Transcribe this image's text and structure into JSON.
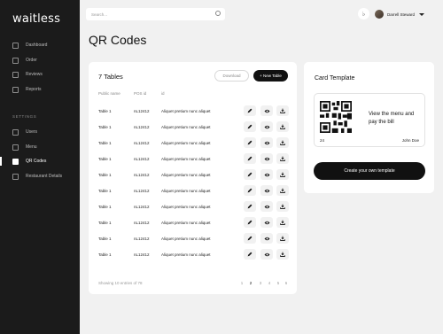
{
  "app": {
    "logo": "waitless"
  },
  "sidebar": {
    "items": [
      {
        "label": "Dashboard",
        "icon": "grid-icon"
      },
      {
        "label": "Order",
        "icon": "order-icon"
      },
      {
        "label": "Reviews",
        "icon": "thumbs-up-icon"
      },
      {
        "label": "Reports",
        "icon": "report-icon"
      }
    ],
    "settings_label": "SETTINGS",
    "settings_items": [
      {
        "label": "Users",
        "icon": "users-icon"
      },
      {
        "label": "Menu",
        "icon": "menu-icon"
      },
      {
        "label": "QR Codes",
        "icon": "qr-icon",
        "active": true
      },
      {
        "label": "Restaurant Details",
        "icon": "details-icon"
      }
    ]
  },
  "topbar": {
    "search_placeholder": "Search...",
    "user_name": "Darrell Steward"
  },
  "page": {
    "title": "QR Codes"
  },
  "tables": {
    "title": "7 Tables",
    "download_label": "Download",
    "new_table_label": "+ New Table",
    "columns": [
      "Public name",
      "POS id",
      "id"
    ],
    "rows": [
      {
        "name": "Table 1",
        "pos": "nL12412",
        "id": "Aliquet pretium nunc aliquet"
      },
      {
        "name": "Table 1",
        "pos": "nL12412",
        "id": "Aliquet pretium nunc aliquet"
      },
      {
        "name": "Table 1",
        "pos": "nL12412",
        "id": "Aliquet pretium nunc aliquet"
      },
      {
        "name": "Table 1",
        "pos": "nL12412",
        "id": "Aliquet pretium nunc aliquet"
      },
      {
        "name": "Table 1",
        "pos": "nL12412",
        "id": "Aliquet pretium nunc aliquet"
      },
      {
        "name": "Table 1",
        "pos": "nL12412",
        "id": "Aliquet pretium nunc aliquet"
      },
      {
        "name": "Table 1",
        "pos": "nL12412",
        "id": "Aliquet pretium nunc aliquet"
      },
      {
        "name": "Table 1",
        "pos": "nL12412",
        "id": "Aliquet pretium nunc aliquet"
      },
      {
        "name": "Table 1",
        "pos": "nL12412",
        "id": "Aliquet pretium nunc aliquet"
      },
      {
        "name": "Table 1",
        "pos": "nL12412",
        "id": "Aliquet pretium nunc aliquet"
      }
    ],
    "row_actions": [
      "pencil-icon",
      "eye-icon",
      "download-icon"
    ],
    "footer_info": "Showing 10 entries of 78",
    "pages": [
      "1",
      "2",
      "3",
      "4",
      "5",
      "6"
    ],
    "current_page": "2"
  },
  "template": {
    "title": "Card Template",
    "view_text": "View the menu and pay the bill",
    "table_number": "24",
    "waiter": "John Doe",
    "create_label": "Create your own template"
  }
}
